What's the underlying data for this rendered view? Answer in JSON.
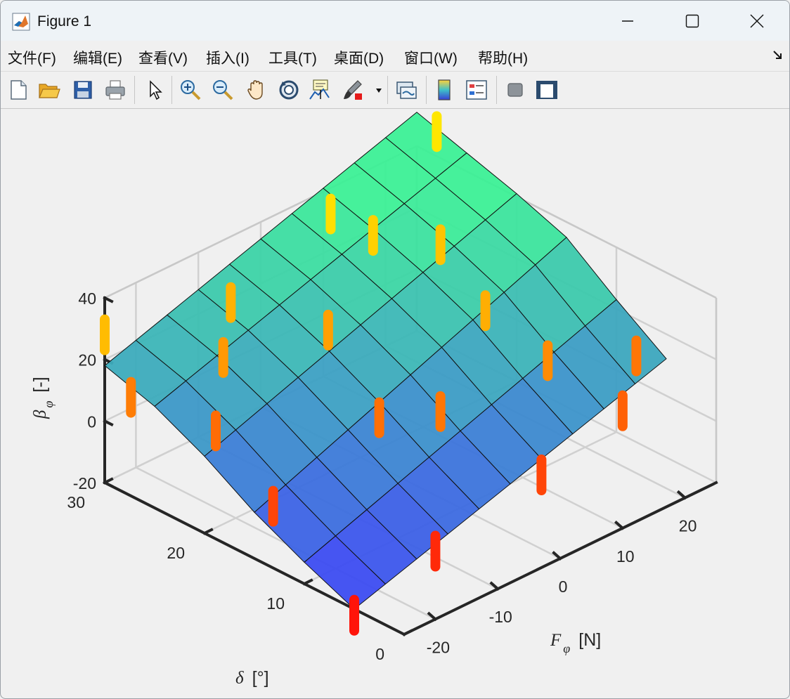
{
  "window": {
    "title": "Figure 1"
  },
  "menu": [
    {
      "label": "文件(F)"
    },
    {
      "label": "编辑(E)"
    },
    {
      "label": "查看(V)"
    },
    {
      "label": "插入(I)"
    },
    {
      "label": "工具(T)"
    },
    {
      "label": "桌面(D)"
    },
    {
      "label": "窗口(W)"
    },
    {
      "label": "帮助(H)"
    }
  ],
  "toolbar": [
    {
      "icon": "new-figure-icon"
    },
    {
      "icon": "open-file-icon"
    },
    {
      "icon": "save-icon"
    },
    {
      "icon": "print-icon"
    },
    {
      "icon": "edit-plot-pointer-icon"
    },
    {
      "icon": "zoom-in-icon"
    },
    {
      "icon": "zoom-out-icon"
    },
    {
      "icon": "pan-hand-icon"
    },
    {
      "icon": "rotate-3d-icon"
    },
    {
      "icon": "data-cursor-icon"
    },
    {
      "icon": "brush-icon"
    },
    {
      "icon": "link-plot-icon"
    },
    {
      "icon": "colorbar-icon"
    },
    {
      "icon": "legend-icon"
    },
    {
      "icon": "hide-plot-tools-icon"
    },
    {
      "icon": "show-plot-tools-icon"
    }
  ],
  "chart_data": {
    "type": "surface3d",
    "xlabel_symbol": "F",
    "xlabel_subscript": "φ",
    "xlabel_unit": "[N]",
    "ylabel_symbol": "δ",
    "ylabel_unit": "[°]",
    "zlabel_symbol": "β",
    "zlabel_subscript": "φ",
    "zlabel_unit": "[-]",
    "x_ticks": [
      -20,
      -10,
      0,
      10,
      20
    ],
    "y_ticks": [
      0,
      10,
      20,
      30
    ],
    "z_ticks": [
      -20,
      0,
      20,
      40
    ],
    "xlim": [
      -25,
      25
    ],
    "ylim": [
      0,
      30
    ],
    "zlim": [
      -20,
      40
    ],
    "colormap": "winter",
    "grid": true,
    "surface_x": [
      -25,
      -20,
      -15,
      -10,
      -5,
      0,
      5,
      10,
      15,
      20,
      25
    ],
    "surface_y": [
      5,
      10,
      15,
      20,
      25,
      30
    ],
    "surface_z": [
      [
        -20,
        -16.8,
        -13.6,
        -10.4,
        -7.2,
        -4,
        -0.8,
        2.4,
        5.6,
        8.8,
        12
      ],
      [
        -13,
        -9.4,
        -5.8,
        -2.2,
        1.4,
        5,
        8.6,
        12.2,
        15.8,
        19.4,
        23
      ],
      [
        -5,
        -1,
        3,
        7,
        11,
        15,
        19,
        23,
        27,
        31,
        35
      ],
      [
        5,
        8.6,
        12.2,
        15.8,
        19.4,
        23,
        26.6,
        30.2,
        33.8,
        37.4,
        41
      ],
      [
        13,
        16.3,
        19.6,
        22.9,
        26.2,
        29.5,
        32.8,
        36.1,
        39.4,
        42.7,
        46
      ],
      [
        18,
        21.3,
        24.6,
        27.9,
        31.2,
        34.5,
        37.8,
        41.1,
        44.4,
        47.7,
        51
      ]
    ],
    "measurements": [
      {
        "x": -25,
        "y": 5,
        "z": -22
      },
      {
        "x": -12,
        "y": 5,
        "z": -14
      },
      {
        "x": 5,
        "y": 5,
        "z": -6
      },
      {
        "x": 18,
        "y": 5,
        "z": 2
      },
      {
        "x": -22,
        "y": 15,
        "z": -6
      },
      {
        "x": -5,
        "y": 15,
        "z": 6
      },
      {
        "x": 12,
        "y": 15,
        "z": 24
      },
      {
        "x": -20,
        "y": 22,
        "z": 5
      },
      {
        "x": -2,
        "y": 22,
        "z": 20
      },
      {
        "x": 16,
        "y": 22,
        "z": 30
      },
      {
        "x": -24,
        "y": 28,
        "z": 10
      },
      {
        "x": -8,
        "y": 28,
        "z": 25
      },
      {
        "x": 8,
        "y": 28,
        "z": 38
      },
      {
        "x": 25,
        "y": 28,
        "z": 48
      },
      {
        "x": 25,
        "y": 8,
        "z": 8
      },
      {
        "x": 14,
        "y": 10,
        "z": 14
      },
      {
        "x": 0,
        "y": 12,
        "z": 8
      },
      {
        "x": -14,
        "y": 25,
        "z": 18
      },
      {
        "x": 10,
        "y": 25,
        "z": 34
      },
      {
        "x": -25,
        "y": 30,
        "z": 28
      }
    ]
  }
}
